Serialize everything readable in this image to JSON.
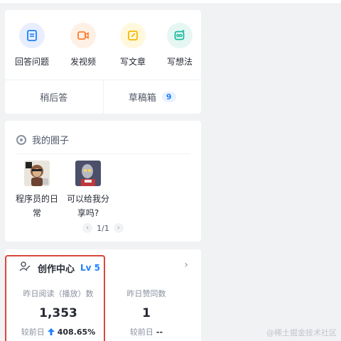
{
  "quick_actions": {
    "items": [
      {
        "label": "回答问题",
        "icon": "answer-doc-icon",
        "bg": "#e8eeff",
        "color": "#1e80ff"
      },
      {
        "label": "发视频",
        "icon": "video-icon",
        "bg": "#fff0e6",
        "color": "#ff7d2a"
      },
      {
        "label": "写文章",
        "icon": "write-article-icon",
        "bg": "#fff8dc",
        "color": "#f5b800"
      },
      {
        "label": "写想法",
        "icon": "idea-icon",
        "bg": "#e6f7f3",
        "color": "#1cb9a0"
      }
    ],
    "later_answer": "稍后答",
    "drafts": "草稿箱",
    "drafts_count": "9"
  },
  "circles": {
    "title": "我的圈子",
    "items": [
      {
        "name": "程序员的日常"
      },
      {
        "name": "可以给我分享吗?"
      }
    ],
    "pager": "1/1"
  },
  "creator": {
    "title": "创作中心",
    "level": "Lv 5",
    "stats": [
      {
        "label": "昨日阅读（播放）数",
        "value": "1,353",
        "change_label": "较前日",
        "change_value": "408.65%",
        "trend": "up"
      },
      {
        "label": "昨日赞同数",
        "value": "1",
        "change_label": "较前日",
        "change_value": "--",
        "trend": "none"
      }
    ],
    "highlight_color": "#d9473d"
  },
  "watermark": "@稀土掘金技术社区"
}
